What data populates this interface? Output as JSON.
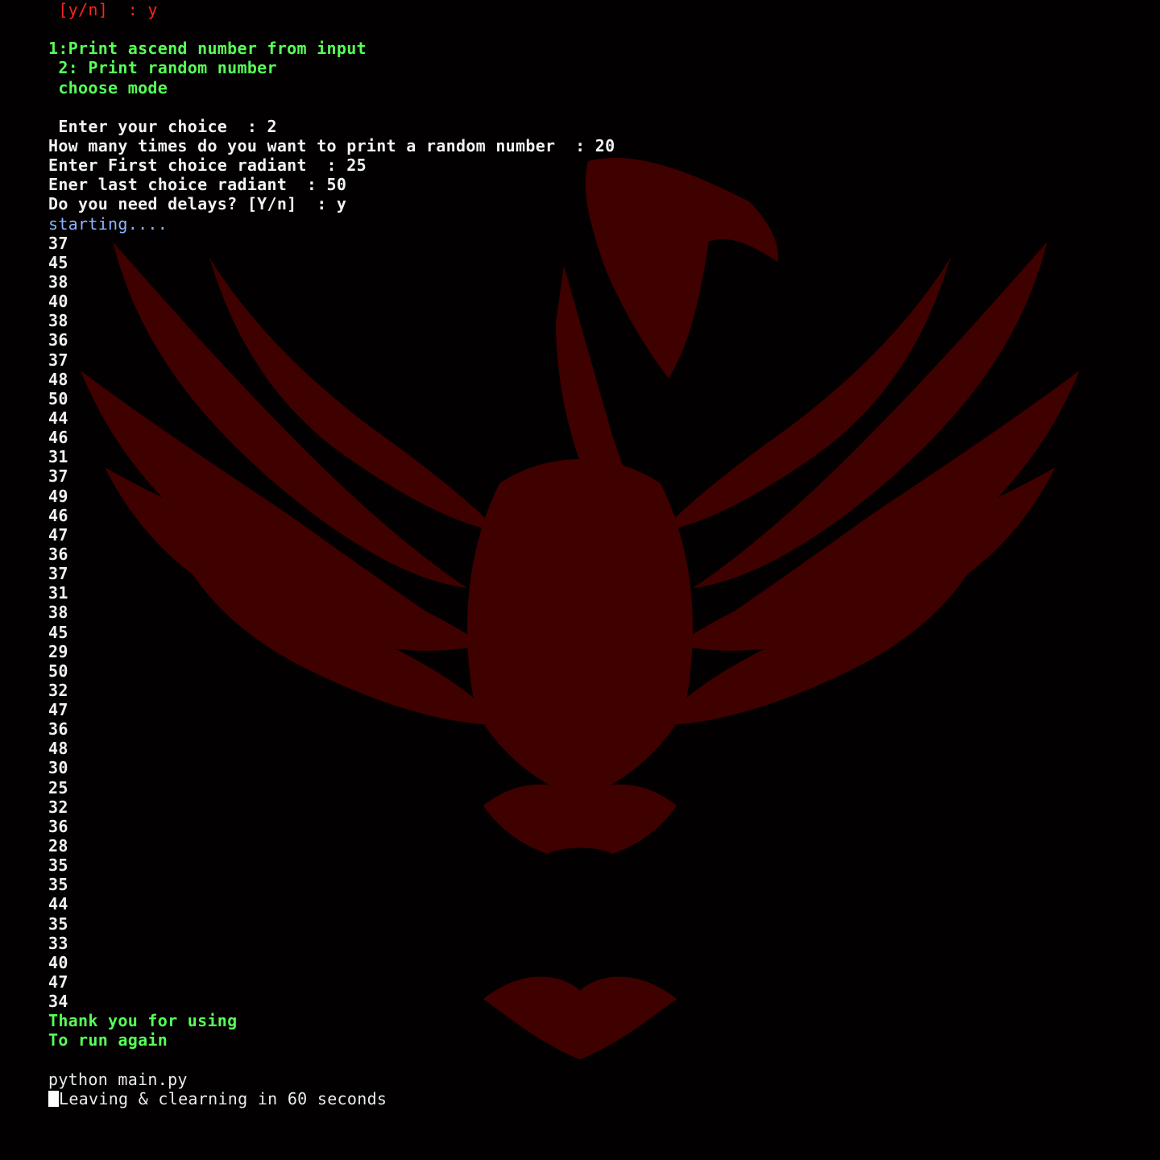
{
  "terminal": {
    "colors": {
      "background": "#000000",
      "prompt_red": "#ff2121",
      "menu_green": "#57ff57",
      "output_white": "#f2f2f2",
      "status_blue": "#8fb4ff",
      "art_red": "#5a0000"
    },
    "background_art": "phoenix-wings-icon",
    "lines": [
      {
        "text": " [y/n]  : y",
        "color": "red"
      },
      {
        "text": "",
        "color": "white"
      },
      {
        "text": "1:Print ascend number from input",
        "color": "green"
      },
      {
        "text": " 2: Print random number",
        "color": "green"
      },
      {
        "text": " choose mode",
        "color": "green"
      },
      {
        "text": "",
        "color": "white"
      },
      {
        "text": " Enter your choice  : 2",
        "color": "white"
      },
      {
        "text": "How many times do you want to print a random number  : 20",
        "color": "white"
      },
      {
        "text": "Enter First choice radiant  : 25",
        "color": "white"
      },
      {
        "text": "Ener last choice radiant  : 50",
        "color": "white"
      },
      {
        "text": "Do you need delays? [Y/n]  : y",
        "color": "white"
      },
      {
        "text": "starting....",
        "color": "blue"
      },
      {
        "text": "37",
        "color": "white"
      },
      {
        "text": "45",
        "color": "white"
      },
      {
        "text": "38",
        "color": "white"
      },
      {
        "text": "40",
        "color": "white"
      },
      {
        "text": "38",
        "color": "white"
      },
      {
        "text": "36",
        "color": "white"
      },
      {
        "text": "37",
        "color": "white"
      },
      {
        "text": "48",
        "color": "white"
      },
      {
        "text": "50",
        "color": "white"
      },
      {
        "text": "44",
        "color": "white"
      },
      {
        "text": "46",
        "color": "white"
      },
      {
        "text": "31",
        "color": "white"
      },
      {
        "text": "37",
        "color": "white"
      },
      {
        "text": "49",
        "color": "white"
      },
      {
        "text": "46",
        "color": "white"
      },
      {
        "text": "47",
        "color": "white"
      },
      {
        "text": "36",
        "color": "white"
      },
      {
        "text": "37",
        "color": "white"
      },
      {
        "text": "31",
        "color": "white"
      },
      {
        "text": "38",
        "color": "white"
      },
      {
        "text": "45",
        "color": "white"
      },
      {
        "text": "29",
        "color": "white"
      },
      {
        "text": "50",
        "color": "white"
      },
      {
        "text": "32",
        "color": "white"
      },
      {
        "text": "47",
        "color": "white"
      },
      {
        "text": "36",
        "color": "white"
      },
      {
        "text": "48",
        "color": "white"
      },
      {
        "text": "30",
        "color": "white"
      },
      {
        "text": "25",
        "color": "white"
      },
      {
        "text": "32",
        "color": "white"
      },
      {
        "text": "36",
        "color": "white"
      },
      {
        "text": "28",
        "color": "white"
      },
      {
        "text": "35",
        "color": "white"
      },
      {
        "text": "35",
        "color": "white"
      },
      {
        "text": "44",
        "color": "white"
      },
      {
        "text": "35",
        "color": "white"
      },
      {
        "text": "33",
        "color": "white"
      },
      {
        "text": "40",
        "color": "white"
      },
      {
        "text": "47",
        "color": "white"
      },
      {
        "text": "34",
        "color": "white"
      },
      {
        "text": "Thank you for using",
        "color": "green"
      },
      {
        "text": "To run again",
        "color": "green"
      },
      {
        "text": "",
        "color": "white"
      },
      {
        "text": "python main.py",
        "color": "white-norm"
      }
    ],
    "last_line": "Leaving & clearning in 60 seconds"
  }
}
